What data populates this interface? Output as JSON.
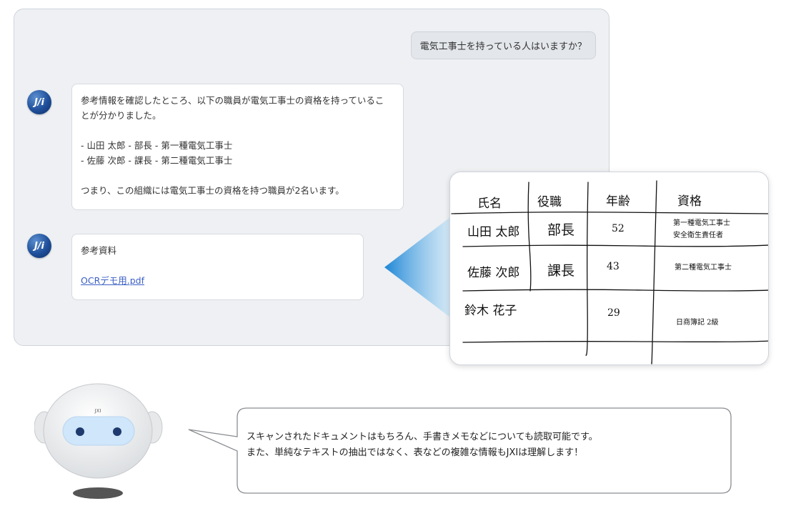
{
  "chat": {
    "user_question": "電気工事士を持っている人はいますか？",
    "avatar_label": "J/i",
    "answer": {
      "line1a": "参考情報を確認したところ、以下の職員が電気工事士の資格を持っているこ",
      "line1b": "とが分かりました。",
      "item1": "- 山田 太郎 - 部長 - 第一種電気工事士",
      "item2": "- 佐藤 次郎 - 課長 - 第二種電気工事士",
      "summary": "つまり、この組織には電気工事士の資格を持つ職員が2名います。"
    },
    "reference": {
      "label": "参考資料",
      "file": "OCRデモ用.pdf"
    }
  },
  "handwritten_table": {
    "headers": [
      "氏名",
      "役職",
      "年齢",
      "資格"
    ],
    "rows": [
      {
        "name": "山田 太郎",
        "position": "部長",
        "age": "52",
        "qualification_1": "第一種電気工事士",
        "qualification_2": "安全衛生責任者"
      },
      {
        "name": "佐藤 次郎",
        "position": "課長",
        "age": "43",
        "qualification_1": "第二種電気工事士",
        "qualification_2": ""
      },
      {
        "name": "鈴木 花子",
        "position": "",
        "age": "29",
        "qualification_1": "日商簿記 2級",
        "qualification_2": ""
      }
    ]
  },
  "robot": {
    "badge": "JXI"
  },
  "speech": {
    "line1": "スキャンされたドキュメントはもちろん、手書きメモなどについても読取可能です。",
    "line2": "また、単純なテキストの抽出ではなく、表などの複雑な情報もJXIは理解します！"
  },
  "colors": {
    "chat_bg": "#eef0f3",
    "avatar": "#1f4f9a",
    "link": "#3b5fc5",
    "pointer": "#2a8fd6",
    "robot_eyes": "#cfe6fb"
  }
}
